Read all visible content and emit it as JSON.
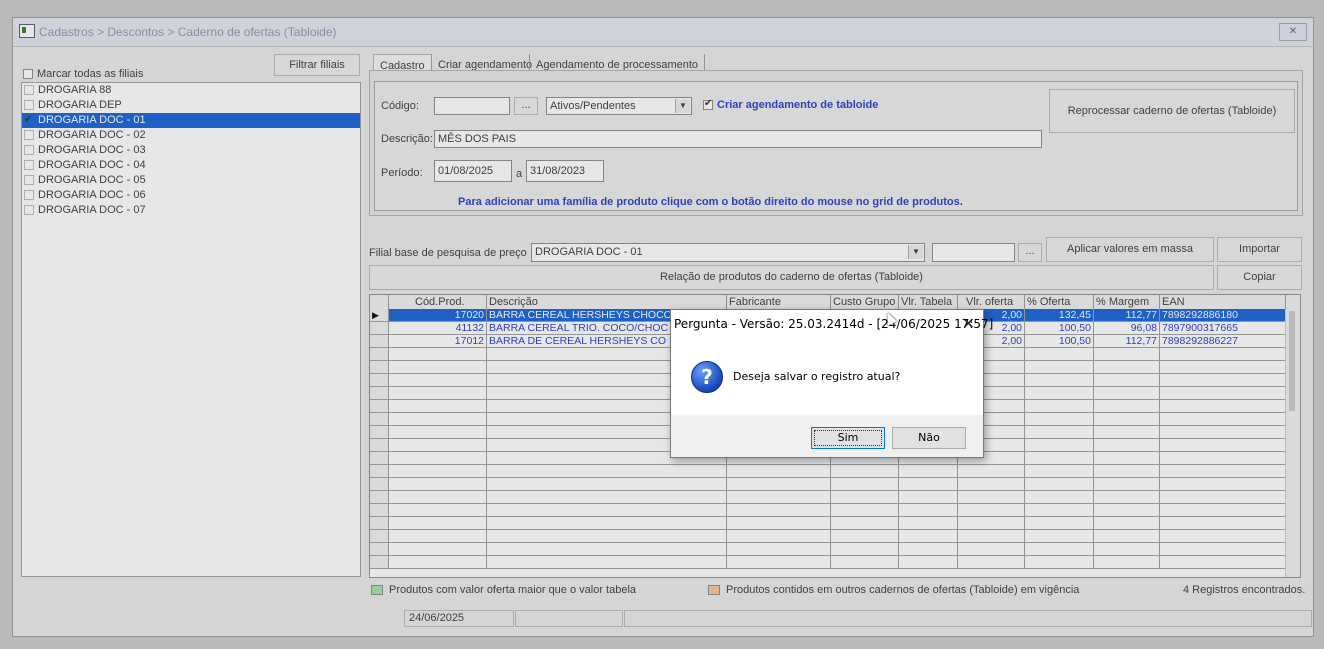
{
  "window": {
    "title": "Cadastros > Descontos > Caderno de ofertas (Tabloide)",
    "close_label": "✕"
  },
  "left": {
    "filter_button": "Filtrar filiais",
    "select_all_label": "Marcar todas as filiais",
    "filiais": [
      {
        "label": "DROGARIA 88",
        "checked": false,
        "selected": false
      },
      {
        "label": "DROGARIA DEP",
        "checked": false,
        "selected": false
      },
      {
        "label": "DROGARIA DOC - 01",
        "checked": true,
        "selected": true
      },
      {
        "label": "DROGARIA DOC - 02",
        "checked": false,
        "selected": false
      },
      {
        "label": "DROGARIA DOC - 03",
        "checked": false,
        "selected": false
      },
      {
        "label": "DROGARIA DOC - 04",
        "checked": false,
        "selected": false
      },
      {
        "label": "DROGARIA DOC - 05",
        "checked": false,
        "selected": false
      },
      {
        "label": "DROGARIA DOC - 06",
        "checked": false,
        "selected": false
      },
      {
        "label": "DROGARIA DOC - 07",
        "checked": false,
        "selected": false
      }
    ]
  },
  "tabs": [
    "Cadastro",
    "Criar agendamento",
    "Agendamento de processamento"
  ],
  "form": {
    "codigo_label": "Código:",
    "codigo_value": "",
    "ellipsis": "...",
    "status_select": "Ativos/Pendentes",
    "criar_agendamento_label": "Criar agendamento de tabloide",
    "descricao_label": "Descrição:",
    "descricao_value": "MÊS DOS PAIS",
    "periodo_label": "Período:",
    "periodo_inicio": "01/08/2025",
    "periodo_sep": "a",
    "periodo_fim": "31/08/2023",
    "reprocessar_button": "Reprocessar caderno de ofertas (Tabloide)",
    "hint": "Para adicionar uma família de produto clique com o botão direito do  mouse no grid de produtos."
  },
  "pricing": {
    "filial_base_label": "Filial base de pesquisa de preço",
    "filial_base_value": "DROGARIA DOC - 01",
    "aplicar_button": "Aplicar valores em massa",
    "importar_button": "Importar",
    "relacao_label": "Relação de produtos do caderno de ofertas (Tabloide)",
    "copiar_button": "Copiar"
  },
  "grid": {
    "columns": [
      "Cód.Prod.",
      "Descrição",
      "Fabricante",
      "Custo Grupo",
      "Vlr. Tabela",
      "Vlr. oferta",
      "% Oferta",
      "% Margem",
      "EAN"
    ],
    "rows": [
      {
        "cod": "17020",
        "desc": "BARRA CEREAL HERSHEYS CHOCO",
        "fab": "",
        "custo": "",
        "tabela": "",
        "oferta": "2,00",
        "pct_oferta": "132,45",
        "margem": "112,77",
        "ean": "7898292886180",
        "selected": true
      },
      {
        "cod": "41132",
        "desc": "BARRA CEREAL TRIO. COCO/CHOC",
        "fab": "",
        "custo": "",
        "tabela": "",
        "oferta": "2,00",
        "pct_oferta": "100,50",
        "margem": "96,08",
        "ean": "7897900317665",
        "selected": false
      },
      {
        "cod": "17012",
        "desc": "BARRA DE CEREAL HERSHEYS CO",
        "fab": "",
        "custo": "",
        "tabela": "",
        "oferta": "2,00",
        "pct_oferta": "100,50",
        "margem": "112,77",
        "ean": "7898292886227",
        "selected": false
      }
    ]
  },
  "legend": {
    "green_label": "Produtos com valor oferta maior que o valor tabela",
    "green_color": "#9fe29f",
    "orange_label": "Produtos contidos em outros cadernos de ofertas (Tabloide) em vigência",
    "orange_color": "#f5c49a",
    "count_label": "4 Registros encontrados."
  },
  "statusbar": {
    "date": "24/06/2025"
  },
  "dialog": {
    "title": "Pergunta - Versão: 25.03.2414d - [24/06/2025 17:57]",
    "message": "Deseja salvar o registro atual?",
    "yes": "Sim",
    "no": "Não",
    "close": "✕"
  }
}
